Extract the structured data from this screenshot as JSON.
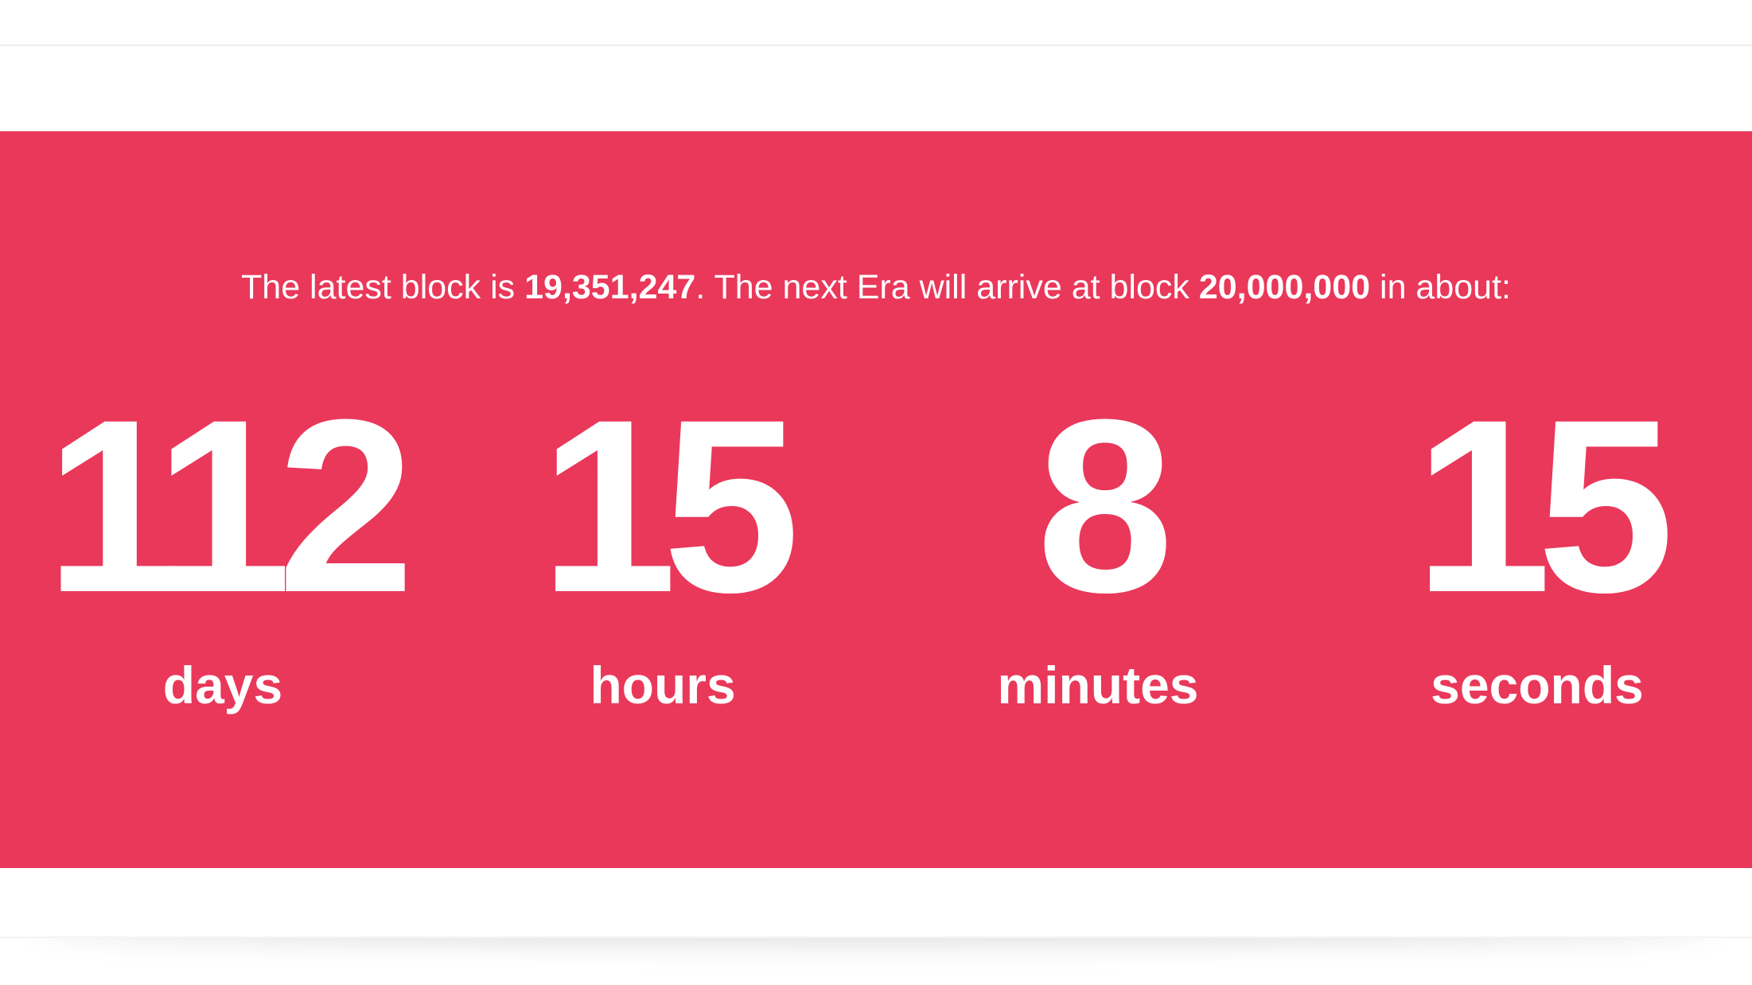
{
  "status": {
    "prefix": "The latest block is ",
    "latest_block": "19,351,247",
    "middle": ". The next Era will arrive at block ",
    "target_block": "20,000,000",
    "suffix": " in about:"
  },
  "countdown": {
    "days": {
      "value": "112",
      "label": "days"
    },
    "hours": {
      "value": "15",
      "label": "hours"
    },
    "minutes": {
      "value": "8",
      "label": "minutes"
    },
    "seconds": {
      "value": "15",
      "label": "seconds"
    }
  },
  "colors": {
    "banner": "#e9385a",
    "text": "#ffffff",
    "page_background": "#ffffff"
  }
}
